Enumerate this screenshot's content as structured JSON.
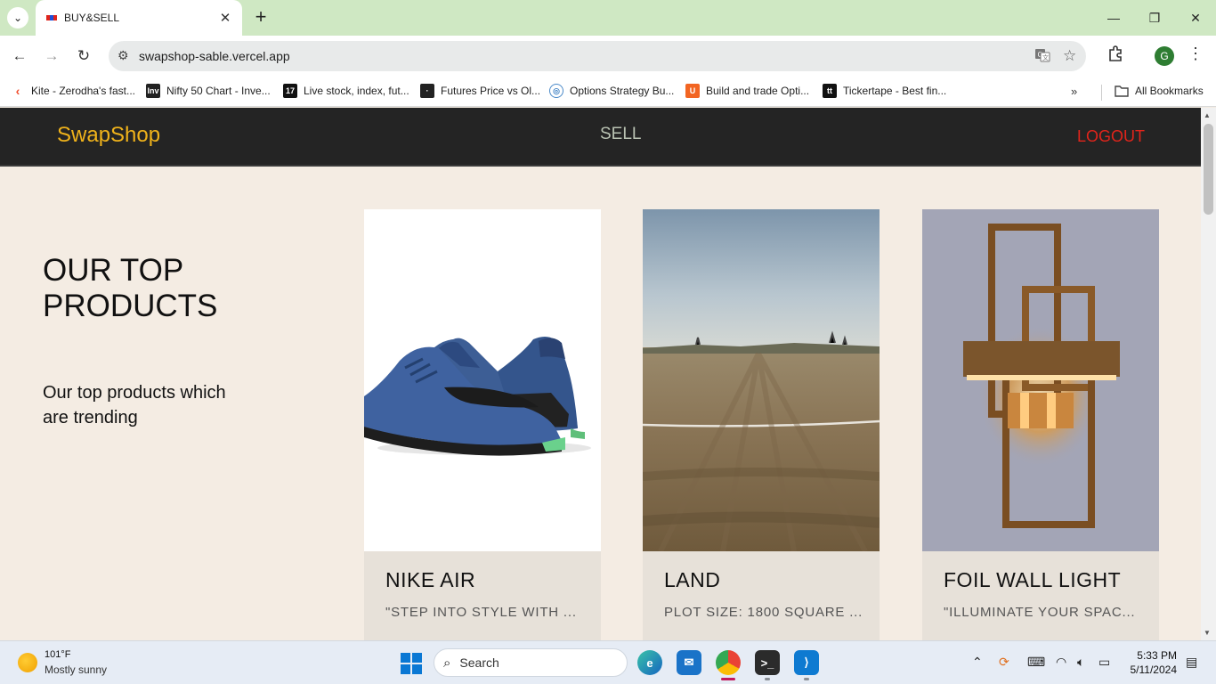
{
  "browser": {
    "tab_title": "BUY&SELL",
    "url": "swapshop-sable.vercel.app",
    "profile_initial": "G",
    "bookmarks": [
      "Kite - Zerodha's fast...",
      "Nifty 50 Chart - Inve...",
      "Live stock, index, fut...",
      "Futures Price vs Ol...",
      "Options Strategy Bu...",
      "Build and trade Opti...",
      "Tickertape - Best fin..."
    ],
    "all_bookmarks": "All Bookmarks"
  },
  "site": {
    "logo": "SwapShop",
    "sell": "SELL",
    "logout": "LOGOUT",
    "heading": "OUR TOP PRODUCTS",
    "subheading": "Our top products which are trending"
  },
  "products": [
    {
      "title": "NIKE AIR",
      "desc": "\"STEP INTO STYLE WITH ..."
    },
    {
      "title": "LAND",
      "desc": "PLOT SIZE: 1800 SQUARE ..."
    },
    {
      "title": "FOIL WALL LIGHT",
      "desc": "\"ILLUMINATE YOUR SPAC..."
    }
  ],
  "taskbar": {
    "temperature": "101°F",
    "weather": "Mostly sunny",
    "search": "Search",
    "time": "5:33 PM",
    "date": "5/11/2024"
  },
  "colors": {
    "tabstrip": "#cfe8c3",
    "header_bg": "#242424",
    "logo": "#efb21b",
    "logout": "#e0241b",
    "page_bg": "#f4ece3",
    "card_body": "#e7e1d9"
  }
}
